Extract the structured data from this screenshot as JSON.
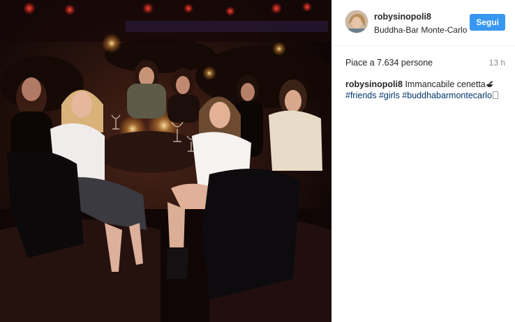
{
  "post": {
    "username": "robysinopoli8",
    "location": "Buddha-Bar Monte-Carlo",
    "follow_label": "Segui",
    "likes_text": "Piace a 7.634 persone",
    "time_ago": "13 h",
    "caption": {
      "username": "robysinopoli8",
      "text": "Immancabile cenetta",
      "hashtags": [
        "#friends",
        "#girls",
        "#buddhabarmontecarlo"
      ]
    }
  },
  "icons": {
    "caption_emoji": "bowl-with-chopsticks-icon",
    "avatar": "profile-avatar"
  },
  "colors": {
    "accent": "#3897f0",
    "hashtag": "#003569",
    "muted": "#8a8a8a",
    "text": "#262626",
    "photo_background": "#1a0c09"
  }
}
